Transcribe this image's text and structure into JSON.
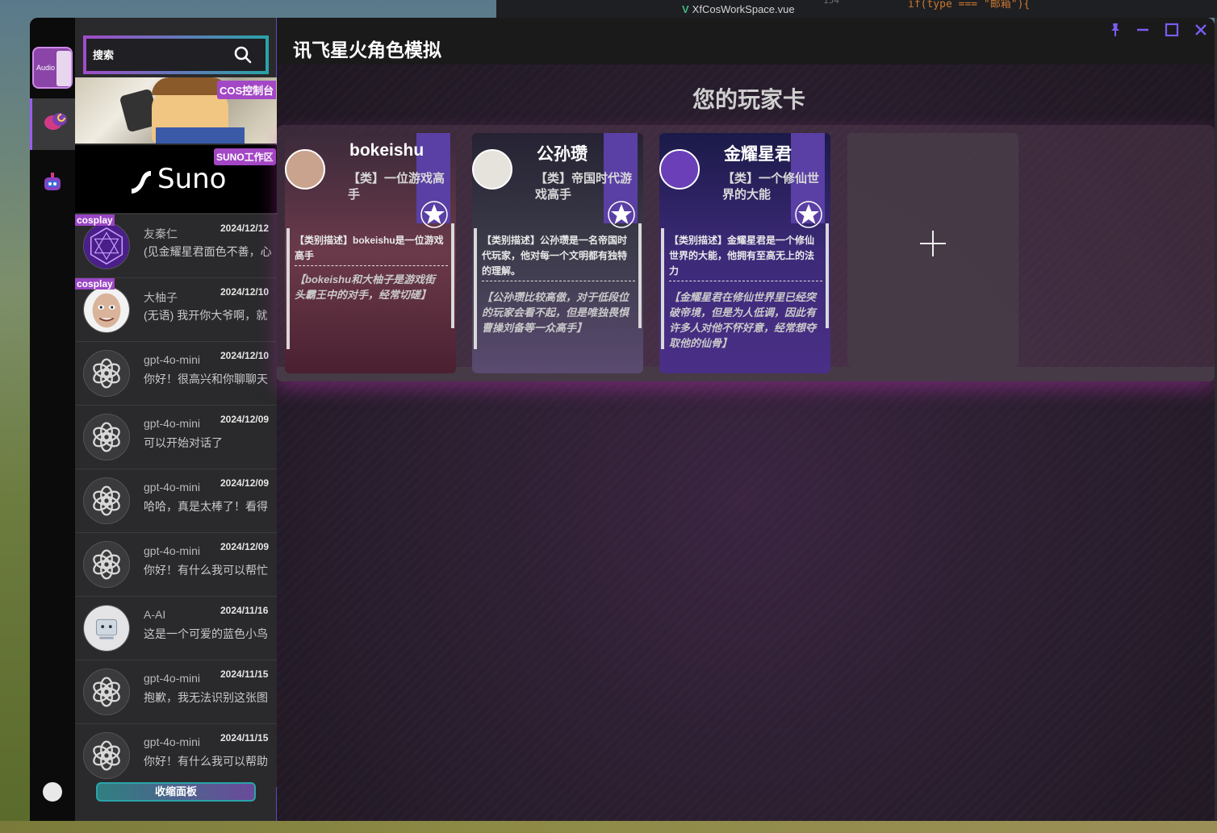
{
  "desktop": {
    "editor_tab": "XfCosWorkSpace.vue",
    "line_number": "154",
    "code_snippet": "if(type === \"邮箱\"){"
  },
  "rail": {
    "audio_label": "Audio"
  },
  "search": {
    "placeholder": "搜索"
  },
  "banners": {
    "cos_label": "COS控制台",
    "suno_label": "SUNO工作区",
    "suno_logo": "Suno"
  },
  "chats": [
    {
      "badge": "cosplay",
      "name": "友秦仁",
      "date": "2024/12/12",
      "preview": "(见金耀星君面色不善，心",
      "avatar": "purple-hex"
    },
    {
      "badge": "cosplay",
      "name": "大柚子",
      "date": "2024/12/10",
      "preview": "(无语) 我开你大爷啊，就",
      "avatar": "face"
    },
    {
      "badge": "",
      "name": "gpt-4o-mini",
      "date": "2024/12/10",
      "preview": "你好！很高兴和你聊聊天",
      "avatar": "openai"
    },
    {
      "badge": "",
      "name": "gpt-4o-mini",
      "date": "2024/12/09",
      "preview": "可以开始对话了",
      "avatar": "openai"
    },
    {
      "badge": "",
      "name": "gpt-4o-mini",
      "date": "2024/12/09",
      "preview": "哈哈，真是太棒了！看得",
      "avatar": "openai"
    },
    {
      "badge": "",
      "name": "gpt-4o-mini",
      "date": "2024/12/09",
      "preview": "你好！有什么我可以帮忙",
      "avatar": "openai"
    },
    {
      "badge": "",
      "name": "A-AI",
      "date": "2024/11/16",
      "preview": "这是一个可爱的蓝色小鸟",
      "avatar": "bird"
    },
    {
      "badge": "",
      "name": "gpt-4o-mini",
      "date": "2024/11/15",
      "preview": "抱歉，我无法识别这张图",
      "avatar": "openai"
    },
    {
      "badge": "",
      "name": "gpt-4o-mini",
      "date": "2024/11/15",
      "preview": "你好！有什么我可以帮助",
      "avatar": "openai"
    }
  ],
  "collapse_label": "收缩面板",
  "header": {
    "title": "讯飞星火角色模拟"
  },
  "section_title": "您的玩家卡",
  "cards": [
    {
      "name": "bokeishu",
      "category": "【类】一位游戏高手",
      "description": "【类别描述】bokeishu是一位游戏高手",
      "quote": "【bokeishu和大柚子是游戏街头霸王中的对手，经常切磋】"
    },
    {
      "name": "公孙瓒",
      "category": "【类】帝国时代游戏高手",
      "description": "【类别描述】公孙瓒是一名帝国时代玩家，他对每一个文明都有独特的理解。",
      "quote": "【公孙瓒比较高傲，对于低段位的玩家会看不起，但是唯独畏惧曹操刘备等一众高手】"
    },
    {
      "name": "金耀星君",
      "category": "【类】一个修仙世界的大能",
      "description": "【类别描述】金耀星君是一个修仙世界的大能，他拥有至高无上的法力",
      "quote": "【金耀星君在修仙世界里已经突破帝境，但是为人低调，因此有许多人对他不怀好意，经常想夺取他的仙骨】"
    }
  ],
  "colors": {
    "accent_purple": "#a347c6",
    "accent_teal": "#2aa3a8",
    "window_controls": "#7b5cf0"
  }
}
